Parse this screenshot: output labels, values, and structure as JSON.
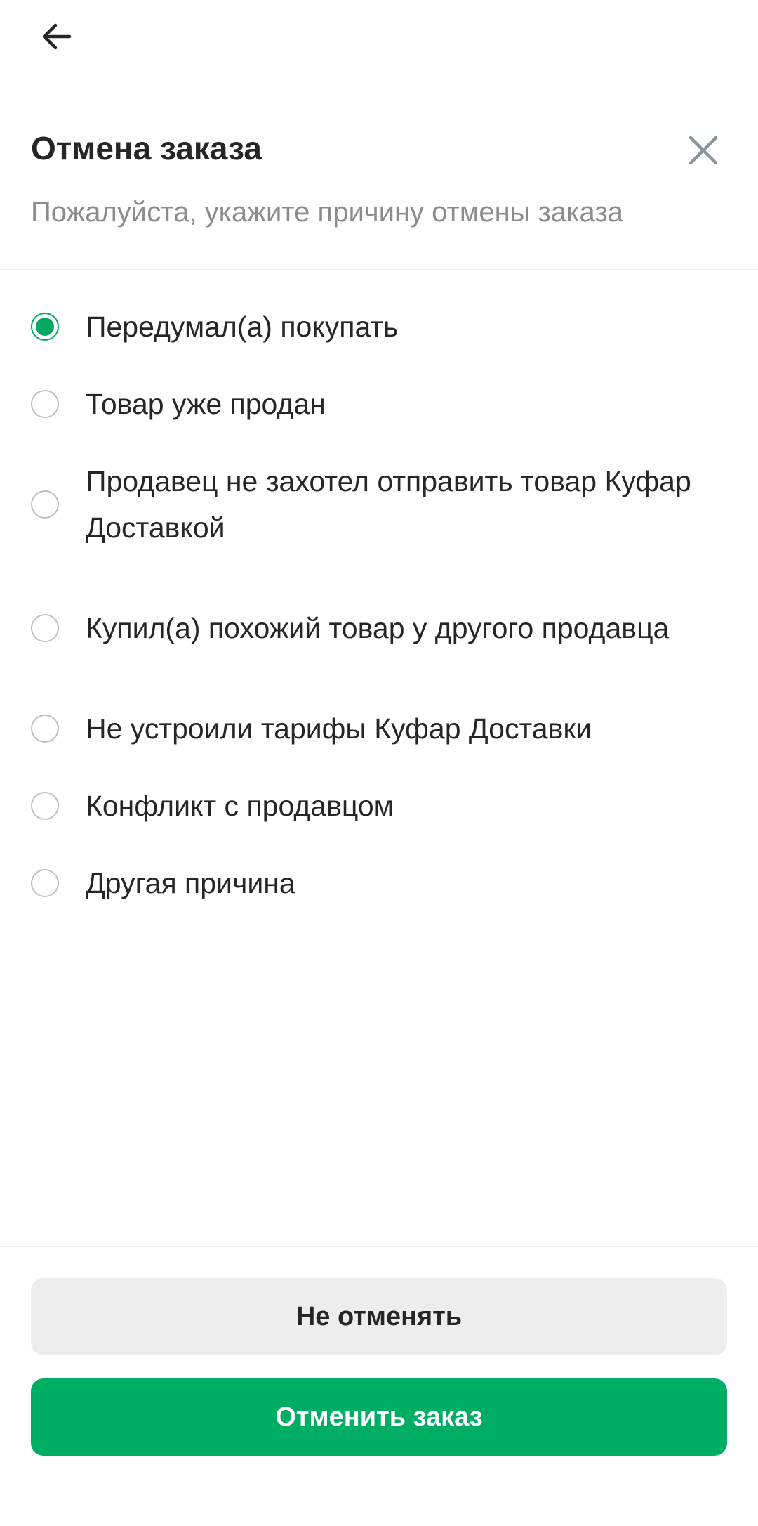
{
  "header": {
    "title": "Отмена заказа",
    "subtitle": "Пожалуйста, укажите причину отмены заказа"
  },
  "icons": {
    "back": "arrow-left-icon",
    "close": "close-icon"
  },
  "reasons": {
    "selected_index": 0,
    "items": [
      {
        "label": "Передумал(а) покупать",
        "checked": true
      },
      {
        "label": "Товар уже продан",
        "checked": false
      },
      {
        "label": "Продавец не захотел отправить товар Куфар Доставкой",
        "checked": false
      },
      {
        "label": "Купил(а) похожий товар у другого продавца",
        "checked": false
      },
      {
        "label": "Не устроили тарифы Куфар Доставки",
        "checked": false
      },
      {
        "label": "Конфликт с продавцом",
        "checked": false
      },
      {
        "label": "Другая причина",
        "checked": false
      }
    ]
  },
  "actions": {
    "keep_label": "Не отменять",
    "cancel_label": "Отменить заказ"
  },
  "colors": {
    "accent": "#00ad65",
    "text": "#262626",
    "muted": "#8c8c8c",
    "secondary_button": "#ededed"
  }
}
